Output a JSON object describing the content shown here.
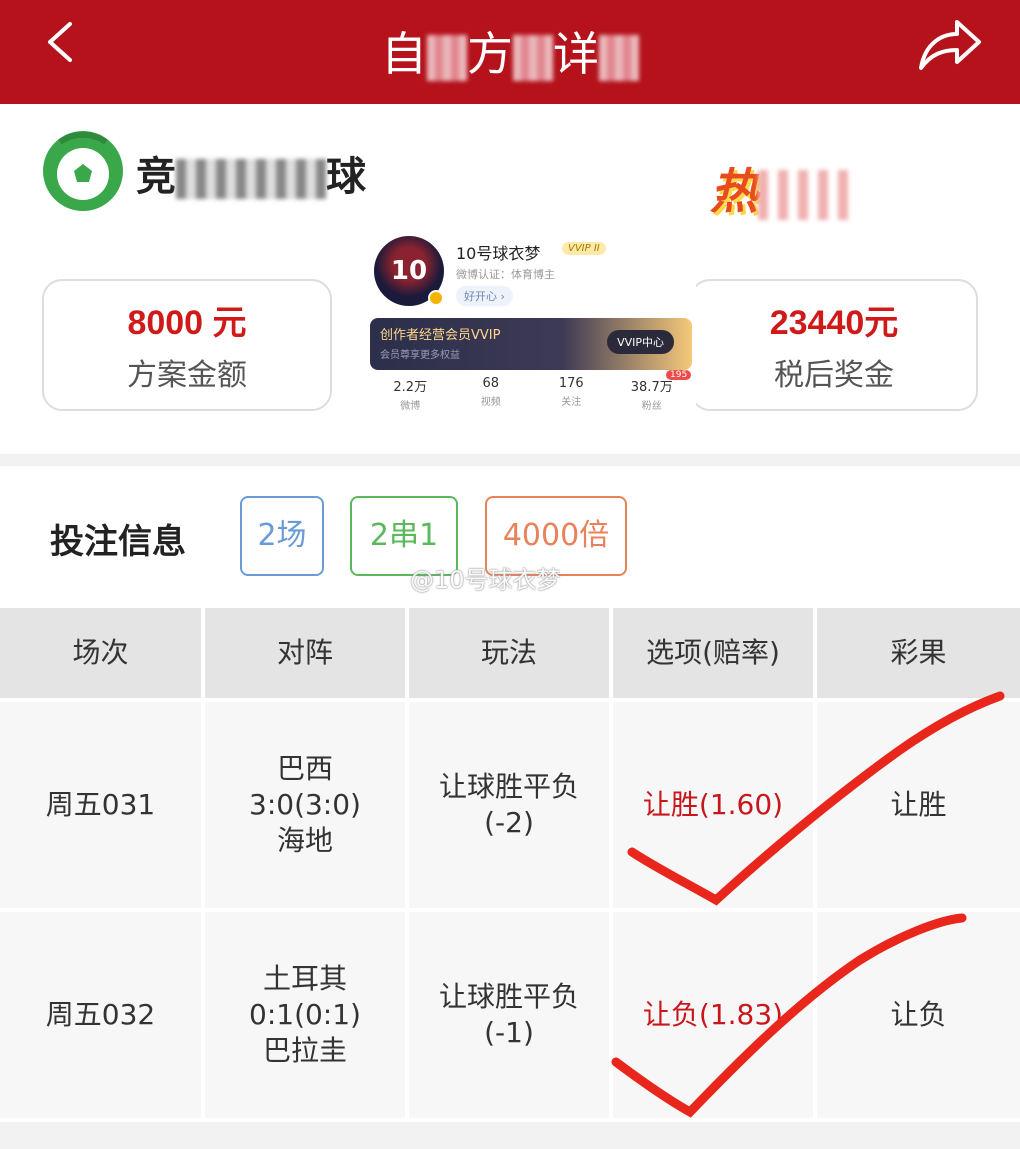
{
  "header": {
    "title_parts": [
      "自",
      "方",
      "详"
    ],
    "back_icon": "chevron-left-icon",
    "share_icon": "share-icon"
  },
  "brand": {
    "name_visible": "竞",
    "name_tail": "球"
  },
  "badge": {
    "text_visible": "热"
  },
  "amounts": {
    "plan": {
      "value": "8000 元",
      "label": "方案金额"
    },
    "prize": {
      "value": "23440元",
      "label": "税后奖金"
    }
  },
  "profile": {
    "avatar_text": "10",
    "name": "10号球衣梦",
    "vip": "VVIP II",
    "verify": "微博认证：体育博主",
    "mood": "好开心 ›",
    "banner_title": "创作者经营会员VVIP",
    "banner_sub": "会员尊享更多权益",
    "banner_button": "VVIP中心",
    "stats": [
      {
        "value": "2.2万",
        "label": "微博"
      },
      {
        "value": "68",
        "label": "视频"
      },
      {
        "value": "176",
        "label": "关注"
      },
      {
        "value": "38.7万",
        "label": "粉丝"
      }
    ],
    "badge_count": "195"
  },
  "bet_info": {
    "title": "投注信息",
    "tags": [
      {
        "text": "2场",
        "color": "#6a9bd6"
      },
      {
        "text": "2串1",
        "color": "#5cb85c"
      },
      {
        "text": "4000倍",
        "color": "#e8825a"
      }
    ],
    "watermark": "@10号球衣梦"
  },
  "table": {
    "headers": [
      "场次",
      "对阵",
      "玩法",
      "选项(赔率)",
      "彩果"
    ],
    "rows": [
      {
        "match_no": "周五031",
        "home": "巴西",
        "score": "3:0(3:0)",
        "away": "海地",
        "play": "让球胜平负",
        "handicap": "(-2)",
        "option": "让胜(1.60)",
        "result": "让胜"
      },
      {
        "match_no": "周五032",
        "home": "土耳其",
        "score": "0:1(0:1)",
        "away": "巴拉圭",
        "play": "让球胜平负",
        "handicap": "(-1)",
        "option": "让负(1.83)",
        "result": "让负"
      }
    ]
  },
  "colors": {
    "header_bg": "#b5121b",
    "accent_red": "#d01a1a",
    "check_red": "#e8261c"
  }
}
